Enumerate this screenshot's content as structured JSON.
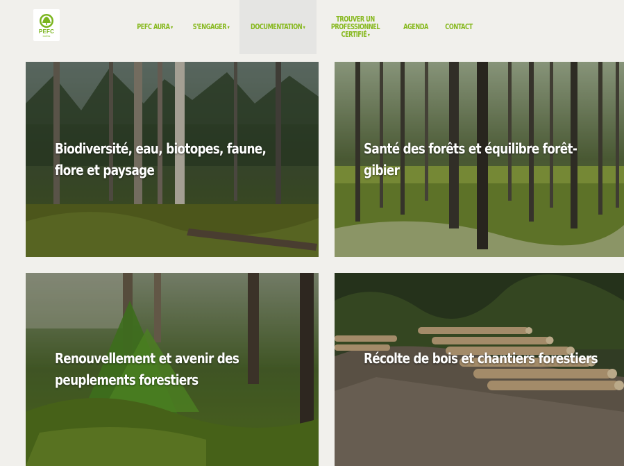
{
  "logo": {
    "text": "PEFC",
    "sub": "RHÔNE"
  },
  "nav": [
    {
      "label": "PEFC AURA",
      "dropdown": true
    },
    {
      "label": "S'ENGAGER",
      "dropdown": true
    },
    {
      "label": "DOCUMENTATION",
      "dropdown": true,
      "active": true
    },
    {
      "label_lines": [
        "TROUVER UN",
        "PROFESSIONNEL",
        "CERTIFIÉ"
      ],
      "dropdown": true
    },
    {
      "label": "AGENDA",
      "dropdown": false
    },
    {
      "label": "CONTACT",
      "dropdown": false
    }
  ],
  "caret": "▾",
  "cards": [
    {
      "title_lines": [
        "Biodiversité, eau, biotopes, faune,",
        "flore et paysage"
      ]
    },
    {
      "title_lines": [
        "Santé des forêts et équilibre forêt-",
        "gibier"
      ]
    },
    {
      "title_lines": [
        "Renouvellement et avenir des",
        "peuplements forestiers"
      ]
    },
    {
      "title_lines": [
        "Récolte de bois et chantiers forestiers"
      ]
    }
  ],
  "colors": {
    "nav": "#86b81d",
    "active_bg": "#e5e5e3",
    "page_bg": "#f1f0ec"
  }
}
